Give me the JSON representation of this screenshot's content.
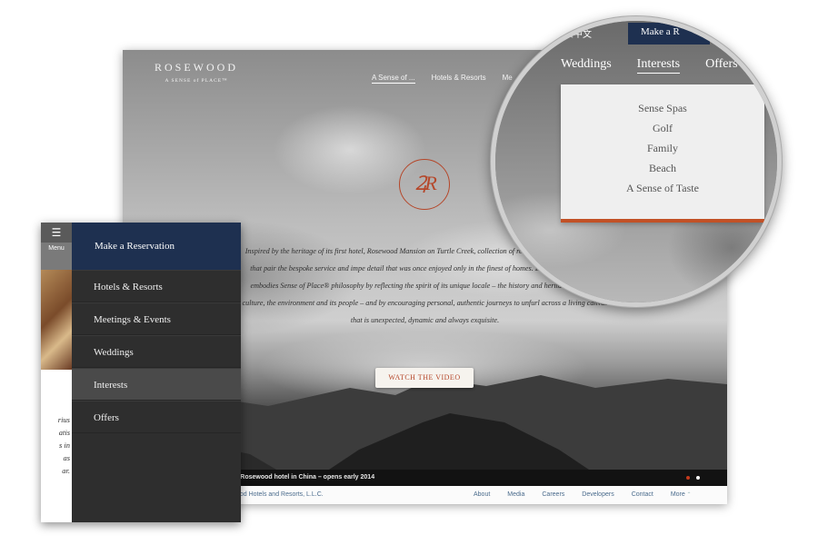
{
  "desktop": {
    "logo": {
      "wordmark": "ROSEWOOD",
      "tagline": "A SENSE of PLACE™"
    },
    "nav": [
      "A Sense of ...",
      "Hotels & Resorts",
      "Me"
    ],
    "emblem": "ꝜR",
    "intro": "Inspired by the heritage of its first hotel, Rosewood Mansion on Turtle Creek, collection of residentially styled properties that pair the bespoke service and impe detail that was once enjoyed only in the finest of homes. Each hotel and resort embodies Sense of Place® philosophy by reflecting the spirit of its unique locale – the history and herita country and culture, the environment and its people – and by encouraging personal, authentic journeys to unfurl across a living canvas that is unexpected, dynamic and always exquisite.",
    "video_button": "WATCH THE VIDEO",
    "news": "t Rosewood hotel in China – opens early 2014",
    "copyright": "ood Hotels and Resorts, L.L.C.",
    "footer_links": [
      "About",
      "Media",
      "Careers",
      "Developers",
      "Contact",
      "More"
    ]
  },
  "mobile": {
    "hamburger": "☰",
    "menu_label": "Menu",
    "reserve": "Make a Reservation",
    "items": [
      "Hotels & Resorts",
      "Meetings & Events",
      "Weddings",
      "Interests",
      "Offers"
    ],
    "active_item": "Interests",
    "side_text": "rius\natis\ns in\nas\nar."
  },
  "magnifier": {
    "language": "繁中文",
    "reserve": "Make a R",
    "nav": [
      "Weddings",
      "Interests",
      "Offers"
    ],
    "active_nav": "Interests",
    "dropdown": [
      "Sense Spas",
      "Golf",
      "Family",
      "Beach",
      "A Sense of Taste"
    ]
  },
  "colors": {
    "navy": "#1e3050",
    "accent": "#c25126",
    "menu_bg": "#2e2e2e"
  }
}
